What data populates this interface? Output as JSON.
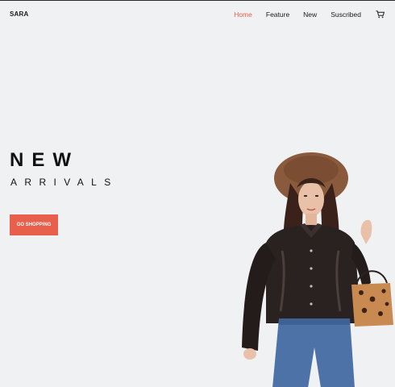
{
  "header": {
    "brand": "SARA",
    "nav": [
      {
        "label": "Home",
        "active": true
      },
      {
        "label": "Feature",
        "active": false
      },
      {
        "label": "New",
        "active": false
      },
      {
        "label": "Suscribed",
        "active": false
      }
    ],
    "cart_icon": "cart-icon"
  },
  "hero": {
    "title": "NEW",
    "subtitle": "ARRIVALS",
    "cta_label": "GO SHOPPING"
  },
  "colors": {
    "accent": "#e8604c",
    "background": "#f0f1f3",
    "text": "#111111"
  }
}
